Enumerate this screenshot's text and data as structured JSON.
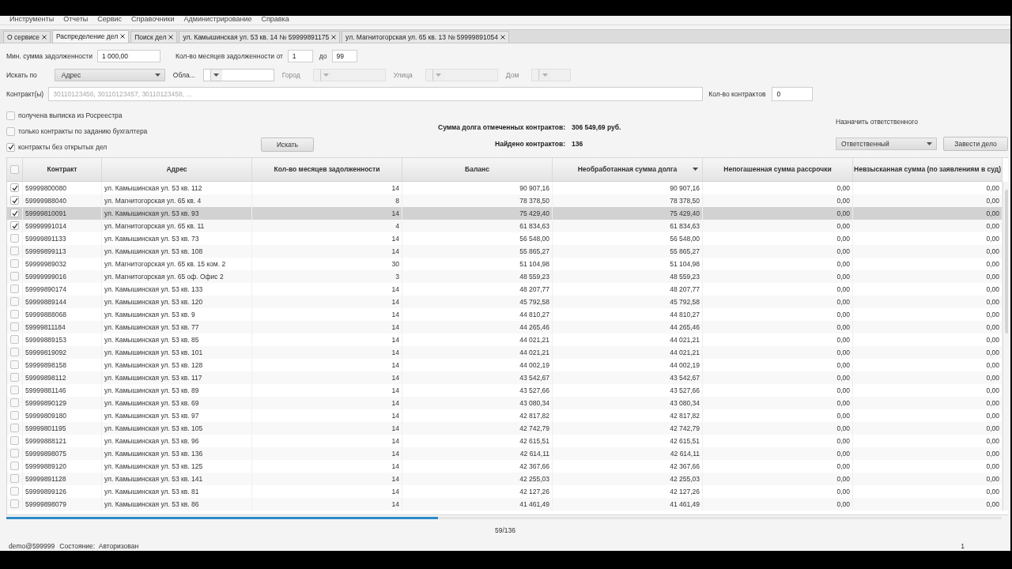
{
  "menu": [
    "Инструменты",
    "Отчеты",
    "Сервис",
    "Справочники",
    "Администрирование",
    "Справка"
  ],
  "tabs": [
    {
      "label": "О сервисе",
      "selected": false
    },
    {
      "label": "Распределение дел",
      "selected": true
    },
    {
      "label": "Поиск дел",
      "selected": false
    },
    {
      "label": "ул. Камышинская ул. 53 кв. 14 № 59999891175",
      "selected": false
    },
    {
      "label": "ул. Магнитогорская ул. 65 кв. 13 № 59999891054",
      "selected": false
    }
  ],
  "filters": {
    "min_debt": {
      "label": "Мин. сумма задолженности",
      "value": "1 000,00"
    },
    "months": {
      "label": "Кол-во месяцев задолженности от",
      "from": "1",
      "to_label": "до",
      "to": "99"
    },
    "search_by": {
      "label": "Искать по",
      "value": "Адрес"
    },
    "location": [
      {
        "label": "Обла...",
        "disabled": false
      },
      {
        "label": "Город",
        "disabled": true
      },
      {
        "label": "Улица",
        "disabled": true
      },
      {
        "label": "Дом",
        "disabled": true
      }
    ],
    "contracts": {
      "label": "Контракт(ы)",
      "placeholder": "30110123456, 30110123457, 30110123458, ..."
    },
    "contract_count": {
      "label": "Кол-во контрактов",
      "value": "0"
    },
    "options": [
      {
        "label": "получена выписка из Росреестра",
        "checked": false
      },
      {
        "label": "только контракты по заданию бухгалтера",
        "checked": false
      },
      {
        "label": "контракты без открытых дел",
        "checked": true
      }
    ],
    "search_button": "Искать"
  },
  "summary": [
    {
      "label": "Сумма долга отмеченных контрактов:",
      "value": "306 549,69 руб."
    },
    {
      "label": "Найдено контрактов:",
      "value": "136"
    }
  ],
  "assign": {
    "label": "Назначить ответственного",
    "dropdown": "Ответственный",
    "button": "Завести дело"
  },
  "table": {
    "select_all_checked": false,
    "columns": [
      {
        "label": "Контракт",
        "sorted": false
      },
      {
        "label": "Адрес",
        "sorted": false
      },
      {
        "label": "Кол-во месяцев задолженности",
        "sorted": false
      },
      {
        "label": "Баланс",
        "sorted": false
      },
      {
        "label": "Необработанная сумма долга",
        "sorted": true
      },
      {
        "label": "Непогашенная сумма рассрочки",
        "sorted": false
      },
      {
        "label": "Невзысканная сумма (по заявлениям в суд)",
        "sorted": false
      }
    ],
    "rows": [
      {
        "checked": true,
        "selected": false,
        "cells": [
          "59999800080",
          "ул. Камышинская ул. 53 кв. 112",
          "14",
          "90 907,16",
          "90 907,16",
          "0,00",
          "0,00"
        ]
      },
      {
        "checked": true,
        "selected": false,
        "cells": [
          "59999988040",
          "ул. Магнитогорская ул. 65 кв. 4",
          "8",
          "78 378,50",
          "78 378,50",
          "0,00",
          "0,00"
        ]
      },
      {
        "checked": true,
        "selected": true,
        "cells": [
          "59999810091",
          "ул. Камышинская ул. 53 кв. 93",
          "14",
          "75 429,40",
          "75 429,40",
          "0,00",
          "0,00"
        ]
      },
      {
        "checked": true,
        "selected": false,
        "cells": [
          "59999991014",
          "ул. Магнитогорская ул. 65 кв. 11",
          "4",
          "61 834,63",
          "61 834,63",
          "0,00",
          "0,00"
        ]
      },
      {
        "checked": false,
        "selected": false,
        "cells": [
          "59999891133",
          "ул. Камышинская ул. 53 кв. 73",
          "14",
          "56 548,00",
          "56 548,00",
          "0,00",
          "0,00"
        ]
      },
      {
        "checked": false,
        "selected": false,
        "cells": [
          "59999899113",
          "ул. Камышинская ул. 53 кв. 108",
          "14",
          "55 865,27",
          "55 865,27",
          "0,00",
          "0,00"
        ]
      },
      {
        "checked": false,
        "selected": false,
        "cells": [
          "59999989032",
          "ул. Магнитогорская ул. 65 кв. 15 ком. 2",
          "30",
          "51 104,98",
          "51 104,98",
          "0,00",
          "0,00"
        ]
      },
      {
        "checked": false,
        "selected": false,
        "cells": [
          "59999999016",
          "ул. Магнитогорская ул. 65 оф. Офис 2",
          "3",
          "48 559,23",
          "48 559,23",
          "0,00",
          "0,00"
        ]
      },
      {
        "checked": false,
        "selected": false,
        "cells": [
          "59999890174",
          "ул. Камышинская ул. 53 кв. 133",
          "14",
          "48 207,77",
          "48 207,77",
          "0,00",
          "0,00"
        ]
      },
      {
        "checked": false,
        "selected": false,
        "cells": [
          "59999889144",
          "ул. Камышинская ул. 53 кв. 120",
          "14",
          "45 792,58",
          "45 792,58",
          "0,00",
          "0,00"
        ]
      },
      {
        "checked": false,
        "selected": false,
        "cells": [
          "59999888068",
          "ул. Камышинская ул. 53 кв. 9",
          "14",
          "44 810,27",
          "44 810,27",
          "0,00",
          "0,00"
        ]
      },
      {
        "checked": false,
        "selected": false,
        "cells": [
          "59999811184",
          "ул. Камышинская ул. 53 кв. 77",
          "14",
          "44 265,46",
          "44 265,46",
          "0,00",
          "0,00"
        ]
      },
      {
        "checked": false,
        "selected": false,
        "cells": [
          "59999889153",
          "ул. Камышинская ул. 53 кв. 85",
          "14",
          "44 021,21",
          "44 021,21",
          "0,00",
          "0,00"
        ]
      },
      {
        "checked": false,
        "selected": false,
        "cells": [
          "59999819092",
          "ул. Камышинская ул. 53 кв. 101",
          "14",
          "44 021,21",
          "44 021,21",
          "0,00",
          "0,00"
        ]
      },
      {
        "checked": false,
        "selected": false,
        "cells": [
          "59999898158",
          "ул. Камышинская ул. 53 кв. 128",
          "14",
          "44 002,19",
          "44 002,19",
          "0,00",
          "0,00"
        ]
      },
      {
        "checked": false,
        "selected": false,
        "cells": [
          "59999898112",
          "ул. Камышинская ул. 53 кв. 117",
          "14",
          "43 542,67",
          "43 542,67",
          "0,00",
          "0,00"
        ]
      },
      {
        "checked": false,
        "selected": false,
        "cells": [
          "59999881146",
          "ул. Камышинская ул. 53 кв. 89",
          "14",
          "43 527,66",
          "43 527,66",
          "0,00",
          "0,00"
        ]
      },
      {
        "checked": false,
        "selected": false,
        "cells": [
          "59999890129",
          "ул. Камышинская ул. 53 кв. 69",
          "14",
          "43 080,34",
          "43 080,34",
          "0,00",
          "0,00"
        ]
      },
      {
        "checked": false,
        "selected": false,
        "cells": [
          "59999809180",
          "ул. Камышинская ул. 53 кв. 97",
          "14",
          "42 817,82",
          "42 817,82",
          "0,00",
          "0,00"
        ]
      },
      {
        "checked": false,
        "selected": false,
        "cells": [
          "59999801195",
          "ул. Камышинская ул. 53 кв. 105",
          "14",
          "42 742,79",
          "42 742,79",
          "0,00",
          "0,00"
        ]
      },
      {
        "checked": false,
        "selected": false,
        "cells": [
          "59999888121",
          "ул. Камышинская ул. 53 кв. 96",
          "14",
          "42 615,51",
          "42 615,51",
          "0,00",
          "0,00"
        ]
      },
      {
        "checked": false,
        "selected": false,
        "cells": [
          "59999898075",
          "ул. Камышинская ул. 53 кв. 136",
          "14",
          "42 614,11",
          "42 614,11",
          "0,00",
          "0,00"
        ]
      },
      {
        "checked": false,
        "selected": false,
        "cells": [
          "59999889120",
          "ул. Камышинская ул. 53 кв. 125",
          "14",
          "42 367,66",
          "42 367,66",
          "0,00",
          "0,00"
        ]
      },
      {
        "checked": false,
        "selected": false,
        "cells": [
          "59999891128",
          "ул. Камышинская ул. 53 кв. 141",
          "14",
          "42 255,03",
          "42 255,03",
          "0,00",
          "0,00"
        ]
      },
      {
        "checked": false,
        "selected": false,
        "cells": [
          "59999899126",
          "ул. Камышинская ул. 53 кв. 81",
          "14",
          "42 127,26",
          "42 127,26",
          "0,00",
          "0,00"
        ]
      },
      {
        "checked": false,
        "selected": false,
        "cells": [
          "59999898079",
          "ул. Камышинская ул. 53 кв. 86",
          "14",
          "41 461,49",
          "41 461,49",
          "0,00",
          "0,00"
        ]
      }
    ]
  },
  "progress": {
    "level": 0.434,
    "text": "59/136"
  },
  "status_bar": {
    "user": "demo@599999",
    "state": "Состояние:  Авторизован",
    "page": "1"
  }
}
